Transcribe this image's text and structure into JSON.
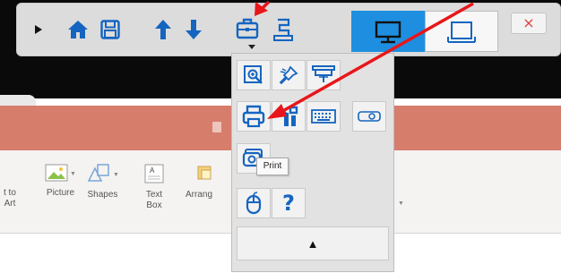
{
  "colors": {
    "accent_blue": "#1e8fe0",
    "icon_blue": "#1565c0",
    "close_red": "#e0403a",
    "header_salmon": "#d67d6c",
    "annotation_red": "#e8161a"
  },
  "toolbar": {
    "icons": [
      "play-icon",
      "home-icon",
      "save-icon",
      "arrow-up-icon",
      "arrow-down-icon",
      "toolbox-icon",
      "paste-icon",
      "desktop-icon",
      "window-icon",
      "close-icon"
    ],
    "close_label": "×"
  },
  "ribbon": {
    "items": [
      {
        "label_1": "t to",
        "label_2": "Art"
      },
      {
        "label_1": "Picture",
        "label_2": ""
      },
      {
        "label_1": "Shapes",
        "label_2": ""
      },
      {
        "label_1": "Text",
        "label_2": "Box"
      },
      {
        "label_1": "Arrang",
        "label_2": ""
      }
    ]
  },
  "panel": {
    "rows": [
      [
        "zoom-in-icon",
        "pin-icon",
        "projector-screen-icon"
      ],
      [
        "print-icon",
        "settings-tools-icon",
        "keyboard-icon",
        "projector-icon"
      ],
      [
        "screen-capture-icon"
      ],
      [
        "mouse-icon",
        "help-icon"
      ]
    ],
    "help_glyph": "?",
    "collapse_glyph": "▲"
  },
  "tooltip": {
    "text": "Print"
  }
}
